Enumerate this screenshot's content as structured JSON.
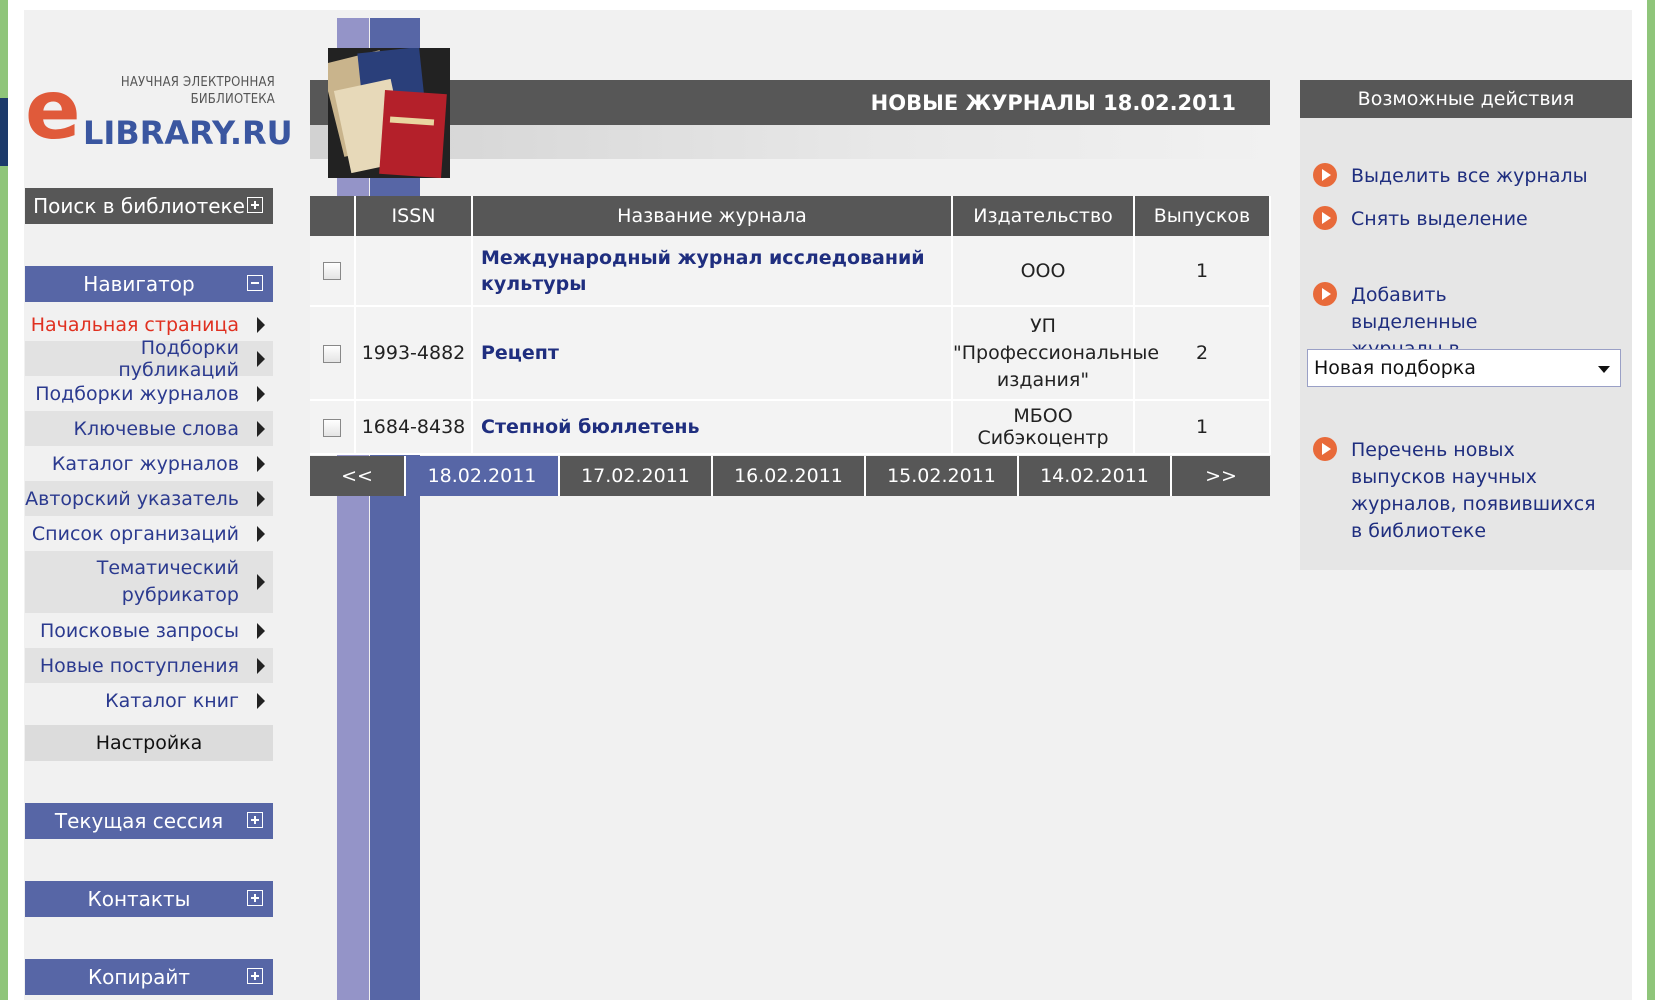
{
  "logo": {
    "top_line1": "НАУЧНАЯ ЭЛЕКТРОННАЯ",
    "top_line2": "БИБЛИОТЕКА",
    "letter": "e",
    "brand": "LIBRARY.RU"
  },
  "left": {
    "search_header": "Поиск в библиотеке",
    "navigator_header": "Навигатор",
    "nav_items": [
      {
        "label": "Начальная страница"
      },
      {
        "label": "Подборки публикаций"
      },
      {
        "label": "Подборки журналов"
      },
      {
        "label": "Ключевые слова"
      },
      {
        "label": "Каталог журналов"
      },
      {
        "label": "Авторский указатель"
      },
      {
        "label": "Список организаций"
      },
      {
        "label": "Тематический рубрикатор"
      },
      {
        "label": "Поисковые запросы"
      },
      {
        "label": "Новые поступления"
      },
      {
        "label": "Каталог книг"
      }
    ],
    "settings": "Настройка",
    "session_header": "Текущая сессия",
    "contacts_header": "Контакты",
    "copyright_header": "Копирайт"
  },
  "main": {
    "title": "НОВЫЕ ЖУРНАЛЫ 18.02.2011",
    "columns": [
      "",
      "ISSN",
      "Название журнала",
      "Издательство",
      "Выпусков"
    ],
    "rows": [
      {
        "issn": "",
        "name": "Международный журнал исследований культуры",
        "publisher": "ООО",
        "issues": "1"
      },
      {
        "issn": "1993-4882",
        "name": "Рецепт",
        "publisher": "УП \"Профессиональные издания\"",
        "issues": "2"
      },
      {
        "issn": "1684-8438",
        "name": "Степной бюллетень",
        "publisher": "МБОО Сибэкоцентр",
        "issues": "1"
      }
    ],
    "date_nav": {
      "prev": "<<",
      "dates": [
        "18.02.2011",
        "17.02.2011",
        "16.02.2011",
        "15.02.2011",
        "14.02.2011"
      ],
      "selected": "18.02.2011",
      "next": ">>"
    }
  },
  "actions": {
    "header": "Возможные действия",
    "select_all": "Выделить все журналы",
    "clear_selection": "Снять выделение",
    "add_selected": "Добавить выделенные журналы в подборку:",
    "collection_select": "Новая подборка",
    "new_issues_list": "Перечень новых выпусков научных журналов, появившихся в библиотеке"
  },
  "colors": {
    "gray_header": "#575757",
    "blue_header": "#5766a6",
    "link": "#1f2e7f",
    "active_link": "#e03020",
    "accent": "#e86a3a"
  }
}
